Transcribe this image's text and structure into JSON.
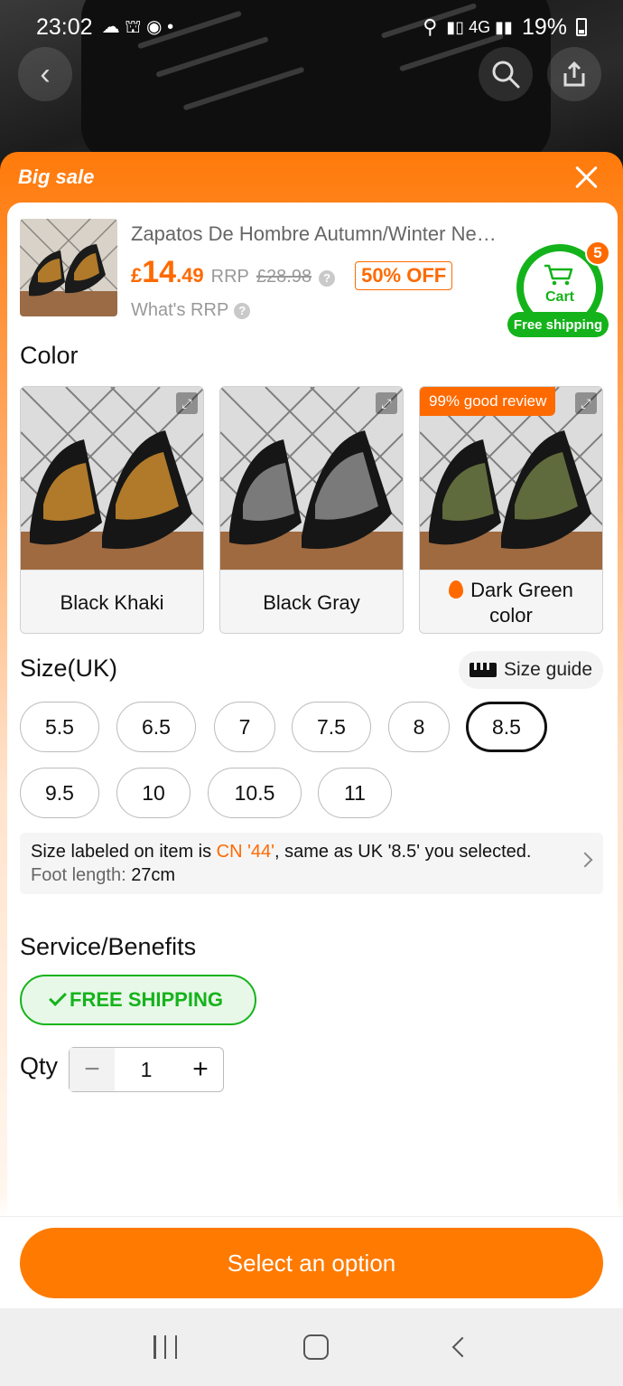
{
  "status_bar": {
    "time": "23:02",
    "battery": "19%"
  },
  "sheet": {
    "header_title": "Big sale"
  },
  "product": {
    "title": "Zapatos De Hombre Autumn/Winter New Hiking ...",
    "price_currency": "£",
    "price_int": "14",
    "price_dec": ".49",
    "rrp_label": "RRP",
    "rrp_value": "£28.98",
    "discount": "50% OFF",
    "whats_rrp": "What's RRP"
  },
  "cart": {
    "label": "Cart",
    "count": "5",
    "shipping": "Free shipping"
  },
  "color_section": {
    "title": "Color",
    "options": [
      {
        "name": "Black Khaki",
        "accent": "#b07a2a"
      },
      {
        "name": "Black Gray",
        "accent": "#7a7a7a"
      },
      {
        "name": "Dark Green color",
        "accent": "#5f6b3c",
        "badge": "99% good review"
      }
    ]
  },
  "size_section": {
    "title": "Size(UK)",
    "guide_label": "Size guide",
    "sizes": [
      "5.5",
      "6.5",
      "7",
      "7.5",
      "8",
      "8.5",
      "9.5",
      "10",
      "10.5",
      "11"
    ],
    "selected": "8.5",
    "info_prefix": "Size labeled on item is ",
    "info_cn": "CN '44'",
    "info_suffix": ", same as UK '8.5' you selected.",
    "foot_label": "Foot length: ",
    "foot_value": "27cm"
  },
  "service": {
    "title": "Service/Benefits",
    "badge": "FREE SHIPPING"
  },
  "qty": {
    "label": "Qty",
    "value": "1",
    "minus": "−",
    "plus": "+"
  },
  "footer": {
    "button": "Select an option"
  },
  "colors": {
    "accent": "#fe6a00",
    "green": "#15b31b"
  }
}
